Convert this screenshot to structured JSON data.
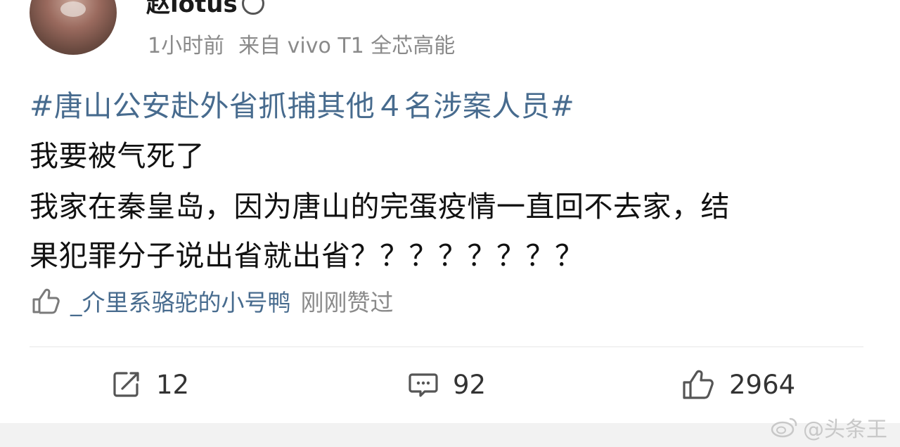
{
  "post": {
    "username": "赵lotus",
    "time": "1小时前",
    "source": "来自 vivo T1 全芯高能",
    "topic": "#唐山公安赴外省抓捕其他４名涉案人员#",
    "lines": [
      "我要被气死了",
      "我家在秦皇岛，因为唐山的完蛋疫情一直回不去家，结",
      "果犯罪分子说出省就出省？？？？？？？？"
    ],
    "liked_by": {
      "user": "_介里系骆驼的小号鸭",
      "text": "刚刚赞过"
    }
  },
  "actions": {
    "repost_count": "12",
    "comment_count": "92",
    "like_count": "2964"
  },
  "watermark": "@头条王",
  "icons": {
    "repost": "repost-icon",
    "comment": "comment-icon",
    "like": "thumbs-up-icon",
    "weibo": "weibo-logo-icon"
  },
  "colors": {
    "topic": "#476b8e",
    "meta": "#8a8a8a"
  }
}
